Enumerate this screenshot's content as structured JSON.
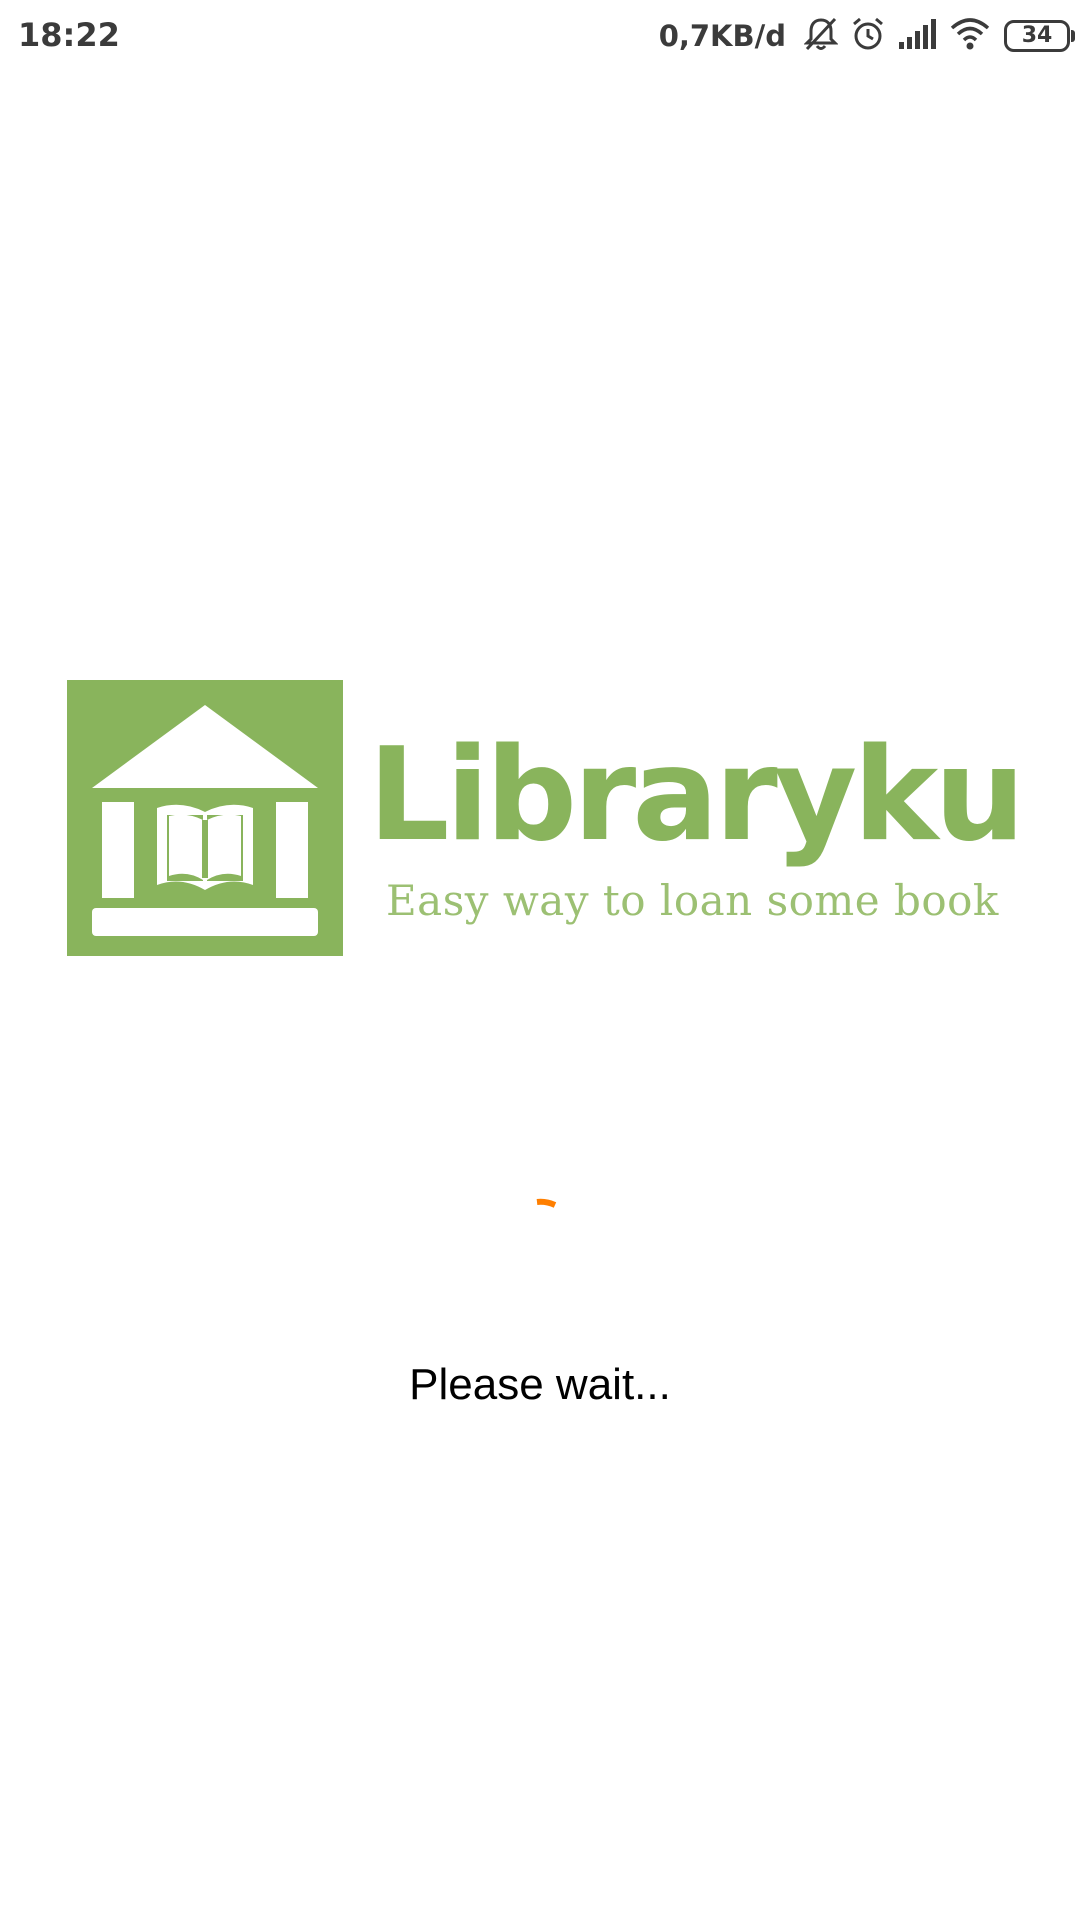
{
  "status_bar": {
    "time": "18:22",
    "network_speed": "0,7KB/d",
    "battery_level": "34",
    "icons": [
      "notifications-muted-icon",
      "alarm-icon",
      "cell-signal-icon",
      "wifi-icon",
      "battery-icon"
    ]
  },
  "splash": {
    "brand_name": "Libraryku",
    "tagline": "Easy way to loan some book",
    "logo_icon": "library-building-icon",
    "loading_message": "Please wait..."
  },
  "colors": {
    "brand_green": "#89b45c",
    "spinner_orange": "#ff7f00",
    "status_text": "#3b3b3b"
  }
}
